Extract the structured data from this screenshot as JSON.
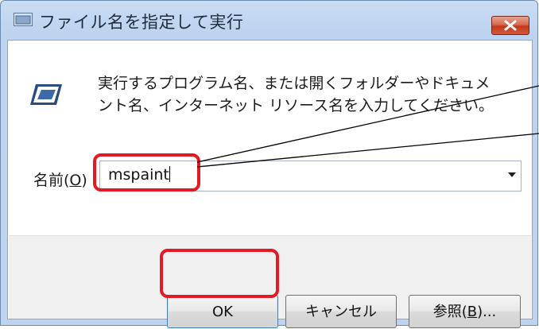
{
  "window": {
    "title": "ファイル名を指定して実行",
    "close_glyph": "✕"
  },
  "dialog": {
    "description": "実行するプログラム名、または開くフォルダーやドキュメ\nント名、インターネット リソース名を入力してください。",
    "name_label_prefix": "名前(",
    "name_label_accel": "O",
    "name_label_suffix": ")",
    "combo_value": "mspaint"
  },
  "buttons": {
    "ok": "OK",
    "cancel": "キャンセル",
    "browse_prefix": "参照(",
    "browse_accel": "B",
    "browse_suffix": ")..."
  },
  "colors": {
    "annotation": "#e21a23",
    "accent": "#3c7fb1"
  }
}
